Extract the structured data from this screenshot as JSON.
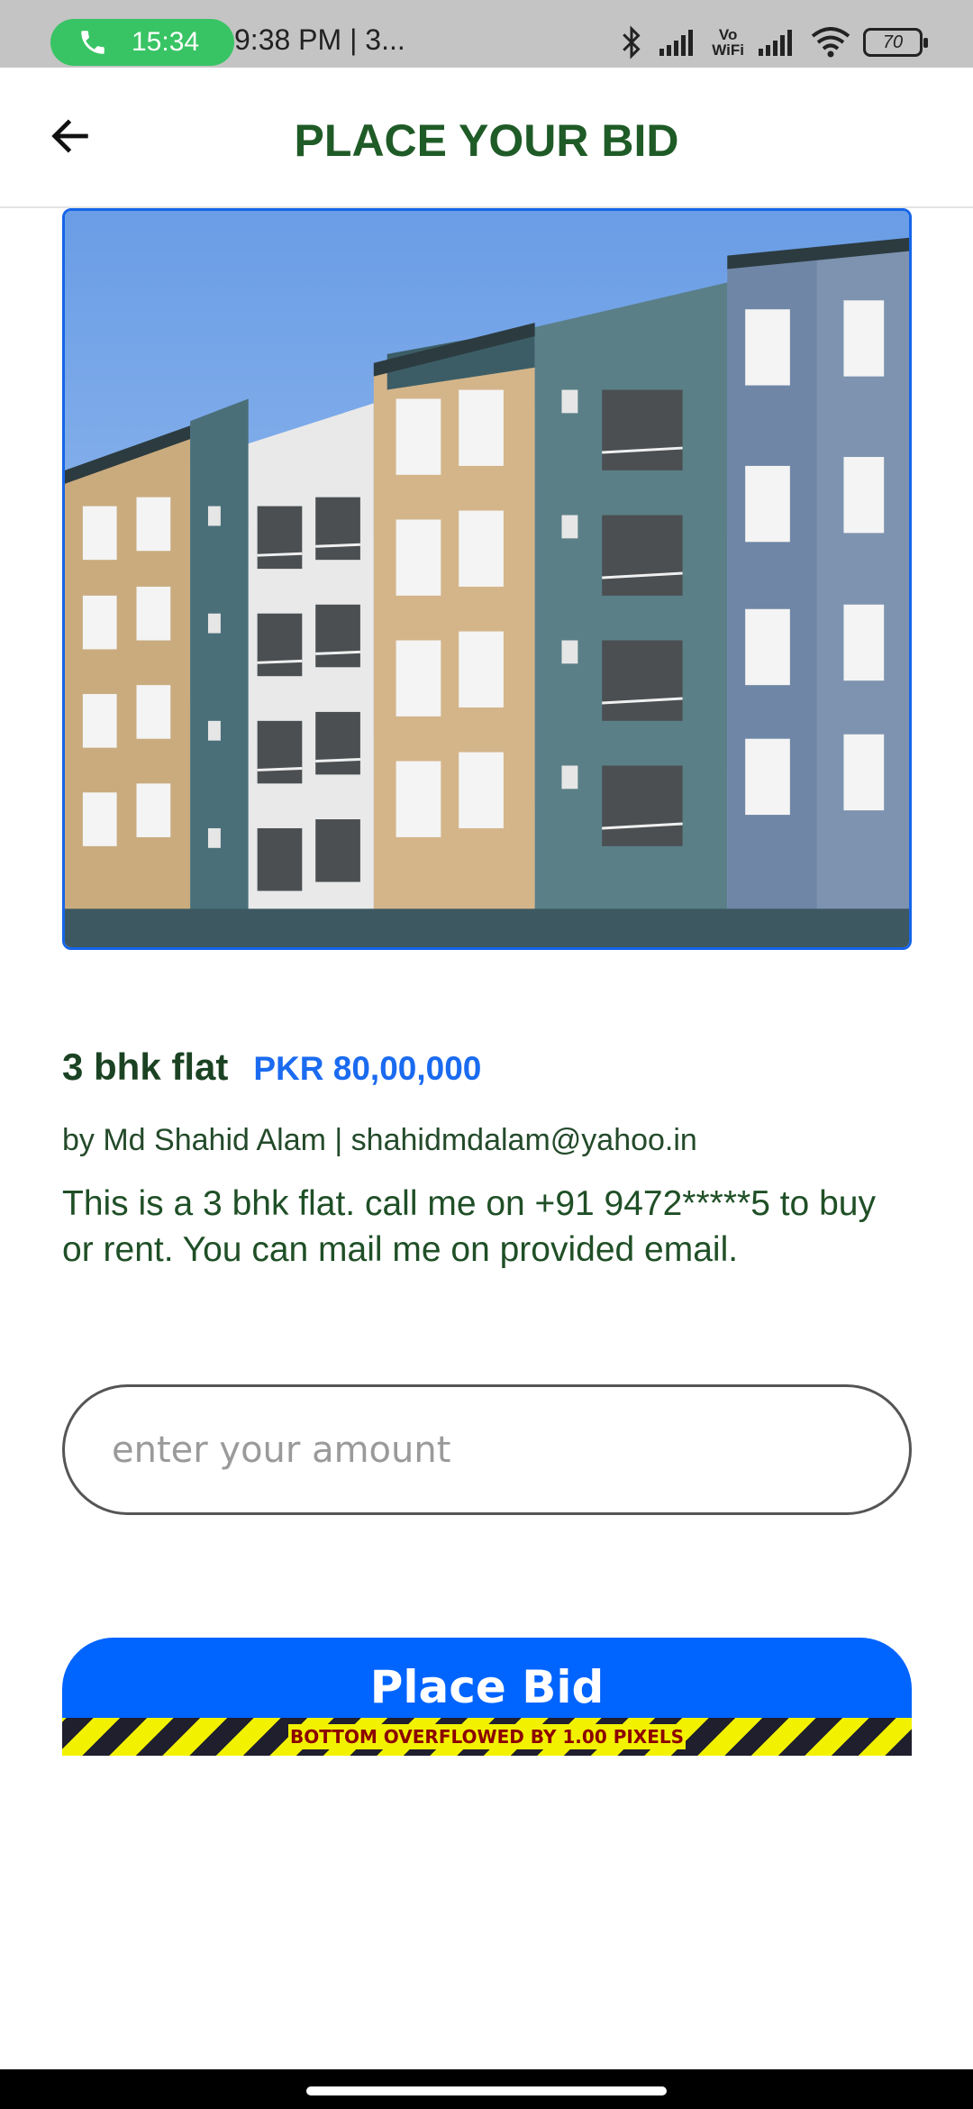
{
  "status_bar": {
    "call_timer": "15:34",
    "notification_text": "9:38 PM | 3...",
    "vowifi_top": "Vo",
    "vowifi_bottom": "WiFi",
    "battery": "70"
  },
  "header": {
    "title": "PLACE YOUR BID"
  },
  "property": {
    "title": "3 bhk flat",
    "price": "PKR 80,00,000",
    "owner_line": "by Md Shahid Alam | shahidmdalam@yahoo.in",
    "description": "This is a 3 bhk flat. call me on +91 9472*****5 to buy or rent. You can mail me on provided email."
  },
  "bid_form": {
    "amount_placeholder": "enter your amount",
    "amount_value": "",
    "submit_label": "Place Bid"
  },
  "debug": {
    "overflow_message": "BOTTOM OVERFLOWED BY 1.00 PIXELS"
  },
  "colors": {
    "title_green": "#1f5b27",
    "price_blue": "#1a6bf0",
    "button_blue": "#0064ff",
    "call_green": "#38c464"
  }
}
